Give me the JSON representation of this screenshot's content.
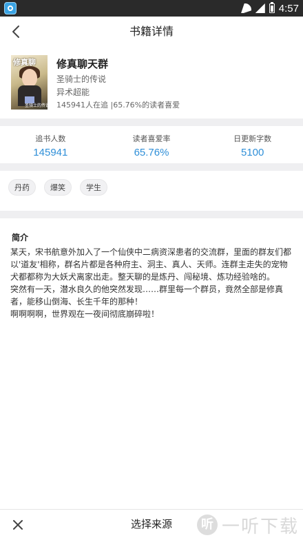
{
  "status_bar": {
    "time": "4:57"
  },
  "header": {
    "title": "书籍详情",
    "back_icon": "back-arrow-icon"
  },
  "book": {
    "title": "修真聊天群",
    "author": "圣骑士的传说",
    "genre": "异术超能",
    "stats_line": "145941人在追 |65.76%的读者喜爱",
    "cover": {
      "title_text": "修真聊",
      "author_text": "圣骑士的传说"
    }
  },
  "stats": [
    {
      "label": "追书人数",
      "value": "145941"
    },
    {
      "label": "读者喜爱率",
      "value": "65.76%"
    },
    {
      "label": "日更新字数",
      "value": "5100"
    }
  ],
  "tags": [
    "丹药",
    "爆笑",
    "学生"
  ],
  "intro": {
    "heading": "简介",
    "text": "某天，宋书航意外加入了一个仙侠中二病资深患者的交流群，里面的群友们都以'道友'相称，群名片都是各种府主、洞主、真人、天师。连群主走失的宠物犬都都称为大妖犬离家出走。整天聊的是炼丹、闯秘境、炼功经验啥的。\n突然有一天，潜水良久的他突然发现……群里每一个群员，竟然全部是修真者，能移山倒海、长生千年的那种！\n啊啊啊啊，世界观在一夜间彻底崩碎啦！"
  },
  "bottom_bar": {
    "source_label": "选择来源",
    "watermark_logo": "听",
    "watermark_text": "一听下载"
  },
  "colors": {
    "accent": "#2f8fd8",
    "separator": "#efeff1",
    "status_bar": "#2a2a2a"
  }
}
